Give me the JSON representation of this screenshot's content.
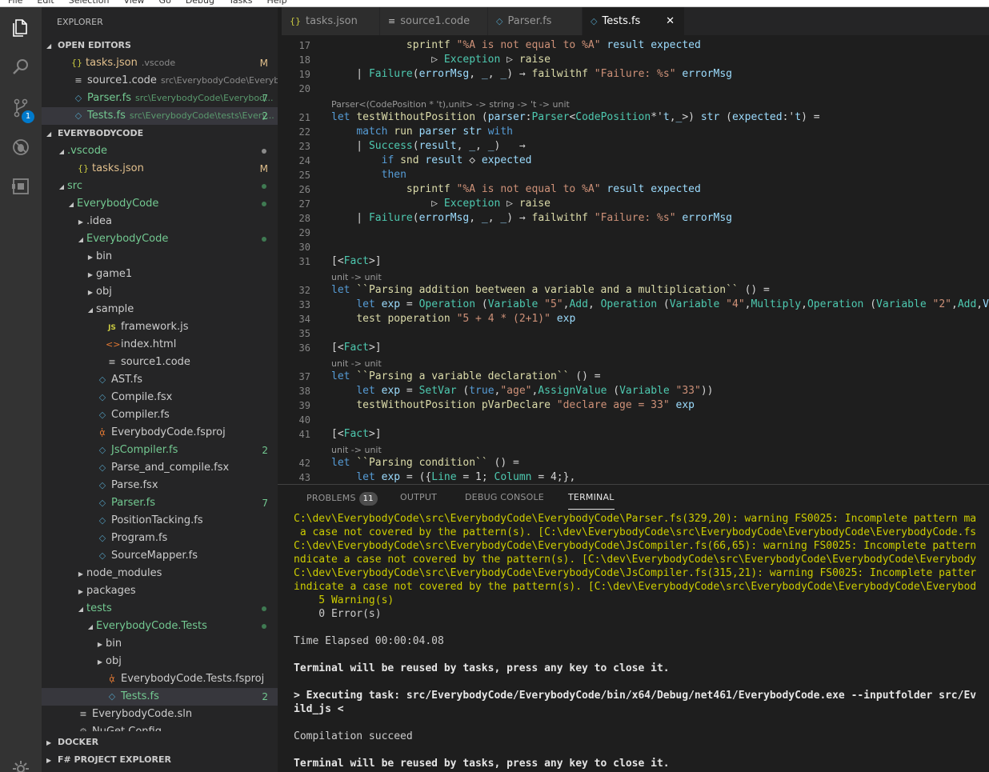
{
  "menubar": [
    "File",
    "Edit",
    "Selection",
    "View",
    "Go",
    "Debug",
    "Tasks",
    "Help"
  ],
  "activity": {
    "scm_badge": "1"
  },
  "sidebar": {
    "title": "EXPLORER",
    "open_editors_header": "OPEN EDITORS",
    "open_editors": [
      {
        "name": "tasks.json",
        "desc": ".vscode",
        "status": "M",
        "icon": "{}",
        "kind": "json"
      },
      {
        "name": "source1.code",
        "desc": "src\\EverybodyCode\\Everybod...",
        "status": "",
        "icon": "≡",
        "kind": "code"
      },
      {
        "name": "Parser.fs",
        "desc": "src\\EverybodyCode\\Everybod...",
        "status": "7",
        "icon": "◇",
        "kind": "fs"
      },
      {
        "name": "Tests.fs",
        "desc": "src\\EverybodyCode\\tests\\Every...",
        "status": "2",
        "icon": "◇",
        "kind": "fs"
      }
    ],
    "project_header": "EVERYBODYCODE",
    "tree": [
      {
        "name": ".vscode",
        "indent": 0,
        "twisty": "open",
        "icon": "",
        "status": "dot"
      },
      {
        "name": "tasks.json",
        "indent": 1,
        "twisty": "",
        "icon": "{}",
        "status": "M"
      },
      {
        "name": "src",
        "indent": 0,
        "twisty": "open",
        "icon": "",
        "status": "dot"
      },
      {
        "name": "EverybodyCode",
        "indent": 1,
        "twisty": "open",
        "icon": "",
        "status": "dot"
      },
      {
        "name": ".idea",
        "indent": 2,
        "twisty": "closed",
        "icon": "",
        "status": ""
      },
      {
        "name": "EverybodyCode",
        "indent": 2,
        "twisty": "open",
        "icon": "",
        "status": "dot"
      },
      {
        "name": "bin",
        "indent": 3,
        "twisty": "closed",
        "icon": "",
        "status": ""
      },
      {
        "name": "game1",
        "indent": 3,
        "twisty": "closed",
        "icon": "",
        "status": ""
      },
      {
        "name": "obj",
        "indent": 3,
        "twisty": "closed",
        "icon": "",
        "status": ""
      },
      {
        "name": "sample",
        "indent": 3,
        "twisty": "open",
        "icon": "",
        "status": ""
      },
      {
        "name": "framework.js",
        "indent": 4,
        "twisty": "",
        "icon": "JS",
        "status": ""
      },
      {
        "name": "index.html",
        "indent": 4,
        "twisty": "",
        "icon": "<>",
        "status": ""
      },
      {
        "name": "source1.code",
        "indent": 4,
        "twisty": "",
        "icon": "≡",
        "status": ""
      },
      {
        "name": "AST.fs",
        "indent": 3,
        "twisty": "",
        "icon": "◇",
        "status": ""
      },
      {
        "name": "Compile.fsx",
        "indent": 3,
        "twisty": "",
        "icon": "◇",
        "status": ""
      },
      {
        "name": "Compiler.fs",
        "indent": 3,
        "twisty": "",
        "icon": "◇",
        "status": ""
      },
      {
        "name": "EverybodyCode.fsproj",
        "indent": 3,
        "twisty": "",
        "icon": "ᾁ",
        "status": ""
      },
      {
        "name": "JsCompiler.fs",
        "indent": 3,
        "twisty": "",
        "icon": "◇",
        "status": "2"
      },
      {
        "name": "Parse_and_compile.fsx",
        "indent": 3,
        "twisty": "",
        "icon": "◇",
        "status": ""
      },
      {
        "name": "Parse.fsx",
        "indent": 3,
        "twisty": "",
        "icon": "◇",
        "status": ""
      },
      {
        "name": "Parser.fs",
        "indent": 3,
        "twisty": "",
        "icon": "◇",
        "status": "7"
      },
      {
        "name": "PositionTacking.fs",
        "indent": 3,
        "twisty": "",
        "icon": "◇",
        "status": ""
      },
      {
        "name": "Program.fs",
        "indent": 3,
        "twisty": "",
        "icon": "◇",
        "status": ""
      },
      {
        "name": "SourceMapper.fs",
        "indent": 3,
        "twisty": "",
        "icon": "◇",
        "status": ""
      },
      {
        "name": "node_modules",
        "indent": 2,
        "twisty": "closed",
        "icon": "",
        "status": ""
      },
      {
        "name": "packages",
        "indent": 2,
        "twisty": "closed",
        "icon": "",
        "status": ""
      },
      {
        "name": "tests",
        "indent": 2,
        "twisty": "open",
        "icon": "",
        "status": "dot"
      },
      {
        "name": "EverybodyCode.Tests",
        "indent": 3,
        "twisty": "open",
        "icon": "",
        "status": "dot"
      },
      {
        "name": "bin",
        "indent": 4,
        "twisty": "closed",
        "icon": "",
        "status": ""
      },
      {
        "name": "obj",
        "indent": 4,
        "twisty": "closed",
        "icon": "",
        "status": ""
      },
      {
        "name": "EverybodyCode.Tests.fsproj",
        "indent": 4,
        "twisty": "",
        "icon": "ᾁ",
        "status": ""
      },
      {
        "name": "Tests.fs",
        "indent": 4,
        "twisty": "",
        "icon": "◇",
        "status": "2",
        "selected": true
      },
      {
        "name": "EverybodyCode.sln",
        "indent": 1,
        "twisty": "",
        "icon": "≡",
        "status": ""
      },
      {
        "name": "NuGet.Config",
        "indent": 1,
        "twisty": "",
        "icon": "⚙",
        "status": ""
      }
    ],
    "docker_header": "DOCKER",
    "fsharp_header": "F# PROJECT EXPLORER"
  },
  "tabs": [
    {
      "label": "tasks.json",
      "icon": "{}",
      "kind": "json",
      "active": false
    },
    {
      "label": "source1.code",
      "icon": "≡",
      "kind": "code",
      "active": false
    },
    {
      "label": "Parser.fs",
      "icon": "◇",
      "kind": "fs",
      "active": false
    },
    {
      "label": "Tests.fs",
      "icon": "◇",
      "kind": "fs",
      "active": true
    }
  ],
  "editor": {
    "lines": [
      {
        "n": "",
        "t": "        then",
        "lens": false
      },
      {
        "n": "17",
        "t": "            sprintf \"%A is not equal to %A\" result expected",
        "lens": false
      },
      {
        "n": "18",
        "t": "                ▷ Exception ▷ raise",
        "lens": false
      },
      {
        "n": "19",
        "t": "    | Failure(errorMsg, _, _) → failwithf \"Failure: %s\" errorMsg",
        "lens": false
      },
      {
        "n": "20",
        "t": "",
        "lens": false
      },
      {
        "n": "",
        "t": "Parser<(CodePosition * 't),unit> -> string -> 't -> unit",
        "lens": true
      },
      {
        "n": "21",
        "t": "let testWithoutPosition (parser:Parser<CodePosition*'t,_>) str (expected:'t) =",
        "lens": false
      },
      {
        "n": "22",
        "t": "    match run parser str with",
        "lens": false
      },
      {
        "n": "23",
        "t": "    | Success(result, _, _)   →",
        "lens": false
      },
      {
        "n": "24",
        "t": "        if snd result ◇ expected",
        "lens": false
      },
      {
        "n": "25",
        "t": "        then",
        "lens": false
      },
      {
        "n": "26",
        "t": "            sprintf \"%A is not equal to %A\" result expected",
        "lens": false
      },
      {
        "n": "27",
        "t": "                ▷ Exception ▷ raise",
        "lens": false
      },
      {
        "n": "28",
        "t": "    | Failure(errorMsg, _, _) → failwithf \"Failure: %s\" errorMsg",
        "lens": false
      },
      {
        "n": "29",
        "t": "",
        "lens": false
      },
      {
        "n": "30",
        "t": "",
        "lens": false
      },
      {
        "n": "31",
        "t": "[<Fact>]",
        "lens": false
      },
      {
        "n": "",
        "t": "unit -> unit",
        "lens": true
      },
      {
        "n": "32",
        "t": "let ``Parsing addition beetween a variable and a multiplication`` () =",
        "lens": false
      },
      {
        "n": "33",
        "t": "    let exp = Operation (Variable \"5\",Add, Operation (Variable \"4\",Multiply,Operation (Variable \"2\",Add,Va",
        "lens": false
      },
      {
        "n": "34",
        "t": "    test poperation \"5 + 4 * (2+1)\" exp",
        "lens": false
      },
      {
        "n": "35",
        "t": "",
        "lens": false
      },
      {
        "n": "36",
        "t": "[<Fact>]",
        "lens": false
      },
      {
        "n": "",
        "t": "unit -> unit",
        "lens": true
      },
      {
        "n": "37",
        "t": "let ``Parsing a variable declaration`` () =",
        "lens": false
      },
      {
        "n": "38",
        "t": "    let exp = SetVar (true,\"age\",AssignValue (Variable \"33\"))",
        "lens": false
      },
      {
        "n": "39",
        "t": "    testWithoutPosition pVarDeclare \"declare age = 33\" exp",
        "lens": false
      },
      {
        "n": "40",
        "t": "",
        "lens": false
      },
      {
        "n": "41",
        "t": "[<Fact>]",
        "lens": false
      },
      {
        "n": "",
        "t": "unit -> unit",
        "lens": true
      },
      {
        "n": "42",
        "t": "let ``Parsing condition`` () =",
        "lens": false
      },
      {
        "n": "43",
        "t": "    let exp = ({Line = 1; Column = 4;},",
        "lens": false
      }
    ]
  },
  "panel": {
    "tabs": [
      {
        "label": "PROBLEMS",
        "badge": "11",
        "active": false
      },
      {
        "label": "OUTPUT",
        "badge": "",
        "active": false
      },
      {
        "label": "DEBUG CONSOLE",
        "badge": "",
        "active": false
      },
      {
        "label": "TERMINAL",
        "badge": "",
        "active": true
      }
    ],
    "terminal": [
      {
        "t": "C:\\dev\\EverybodyCode\\src\\EverybodyCode\\EverybodyCode\\Parser.fs(329,20): warning FS0025: Incomplete pattern ma",
        "s": "warn"
      },
      {
        "t": " a case not covered by the pattern(s). [C:\\dev\\EverybodyCode\\src\\EverybodyCode\\EverybodyCode\\EverybodyCode.fs",
        "s": "warn"
      },
      {
        "t": "C:\\dev\\EverybodyCode\\src\\EverybodyCode\\EverybodyCode\\JsCompiler.fs(66,65): warning FS0025: Incomplete pattern",
        "s": "warn"
      },
      {
        "t": "ndicate a case not covered by the pattern(s). [C:\\dev\\EverybodyCode\\src\\EverybodyCode\\EverybodyCode\\Everybody",
        "s": "warn"
      },
      {
        "t": "C:\\dev\\EverybodyCode\\src\\EverybodyCode\\EverybodyCode\\JsCompiler.fs(315,21): warning FS0025: Incomplete patter",
        "s": "warn"
      },
      {
        "t": "indicate a case not covered by the pattern(s). [C:\\dev\\EverybodyCode\\src\\EverybodyCode\\EverybodyCode\\Everybod",
        "s": "warn"
      },
      {
        "t": "    5 Warning(s)",
        "s": "warn"
      },
      {
        "t": "    0 Error(s)",
        "s": "norm"
      },
      {
        "t": "",
        "s": "norm"
      },
      {
        "t": "Time Elapsed 00:00:04.08",
        "s": "norm"
      },
      {
        "t": "",
        "s": "norm"
      },
      {
        "t": "Terminal will be reused by tasks, press any key to close it.",
        "s": "bold"
      },
      {
        "t": "",
        "s": "norm"
      },
      {
        "t": "> Executing task: src/EverybodyCode/EverybodyCode/bin/x64/Debug/net461/EverybodyCode.exe --inputfolder src/Ev",
        "s": "bold"
      },
      {
        "t": "ild_js <",
        "s": "bold"
      },
      {
        "t": "",
        "s": "norm"
      },
      {
        "t": "Compilation succeed",
        "s": "norm"
      },
      {
        "t": "",
        "s": "norm"
      },
      {
        "t": "Terminal will be reused by tasks, press any key to close it.",
        "s": "bold"
      }
    ]
  },
  "colors": {
    "accent": "#007acc",
    "untracked": "#73c991",
    "modified": "#e2c08d",
    "error": "#c74e39"
  }
}
